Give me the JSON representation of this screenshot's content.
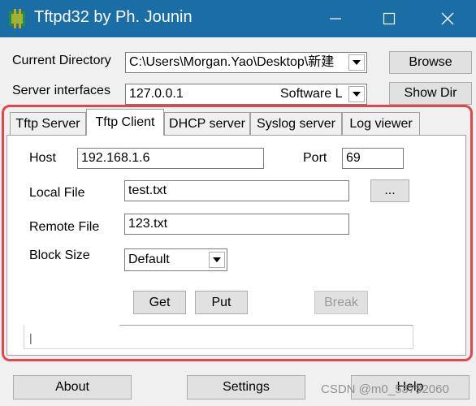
{
  "window": {
    "title": "Tftpd32 by Ph. Jounin",
    "minimize_glyph": "—",
    "maximize_glyph": "☐",
    "close_glyph": "✕"
  },
  "settings": {
    "current_directory_label": "Current Directory",
    "current_directory_value": "C:\\Users\\Morgan.Yao\\Desktop\\新建",
    "server_interfaces_label": "Server interfaces",
    "server_interface_ip": "127.0.0.1",
    "server_interface_desc": "Software L",
    "browse_label": "Browse",
    "show_dir_label": "Show Dir"
  },
  "tabs": [
    {
      "label": "Tftp Server"
    },
    {
      "label": "Tftp Client"
    },
    {
      "label": "DHCP server"
    },
    {
      "label": "Syslog server"
    },
    {
      "label": "Log viewer"
    }
  ],
  "client": {
    "host_label": "Host",
    "host_value": "192.168.1.6",
    "port_label": "Port",
    "port_value": "69",
    "local_file_label": "Local File",
    "local_file_value": "test.txt",
    "browse_local_label": "...",
    "remote_file_label": "Remote File",
    "remote_file_value": "123.txt",
    "block_size_label": "Block Size",
    "block_size_value": "Default",
    "get_label": "Get",
    "put_label": "Put",
    "break_label": "Break",
    "status_text": "|"
  },
  "footer": {
    "about_label": "About",
    "settings_label": "Settings",
    "help_label": "Help"
  },
  "watermark": "CSDN @m0_53732060",
  "colors": {
    "titlebar": "#1a6da5",
    "highlight": "#e4454a"
  }
}
